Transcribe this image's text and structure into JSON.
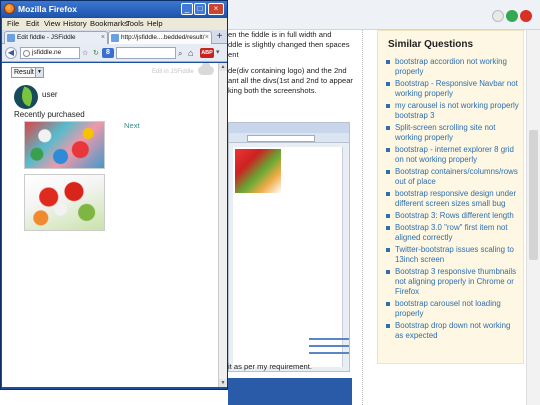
{
  "browser": {
    "title": "Mozilla Firefox",
    "menu": [
      "File",
      "Edit",
      "View",
      "History",
      "Bookmarks",
      "Tools",
      "Help"
    ],
    "tabs": [
      {
        "label": "Edit fiddle - JSFiddle",
        "close": "×"
      },
      {
        "label": "http://jsfiddle....bedded/result/",
        "close": "×"
      }
    ],
    "new_tab": "+",
    "url": "jsfiddle.ne",
    "search_engine": "8",
    "abp_label": "ABP",
    "window_buttons": {
      "minimize": "_",
      "maximize": "□",
      "close": "×"
    }
  },
  "fiddle": {
    "result_select": "Result",
    "edit_link": "Edit in JSFiddle",
    "user_label": "user",
    "recently_label": "Recently purchased",
    "next_link": "Next"
  },
  "question": {
    "paragraphs": [
      "en the fiddle is in full width and",
      "ddle is slightly changed then spaces",
      "ent",
      "de(div containing logo) and the 2nd",
      "ant all the divs(1st and 2nd to appear",
      "king both the screenshots."
    ],
    "bottom_text": "it as per my requirement."
  },
  "sidebar": {
    "title": "Similar Questions",
    "items": [
      "bootstrap accordion not working properly",
      "Bootstrap - Responsive Navbar not working properly",
      "my carousel is not working properly bootstrap 3",
      "Split-screen scrolling site not working properly",
      "bootstrap - internet explorer 8 grid on not working properly",
      "Bootstrap containers/columns/rows out of place",
      "bootstrap responsive design under different screen sizes small bug",
      "Bootstrap 3: Rows different length",
      "Bootstrap 3.0 \"row\" first item not aligned correctly",
      "Twitter-bootstrap issues scaling to 13inch screen",
      "Bootstrap 3 responsive thumbnails not aligning properly in Chrome or Firefox",
      "bootstrap carousel not loading properly",
      "Bootstrap drop down not working as expected"
    ]
  },
  "colors": {
    "firefox_frame": "#1d4fa0",
    "link_blue": "#2f6fae",
    "sidebar_bg": "#fdf7e3"
  }
}
